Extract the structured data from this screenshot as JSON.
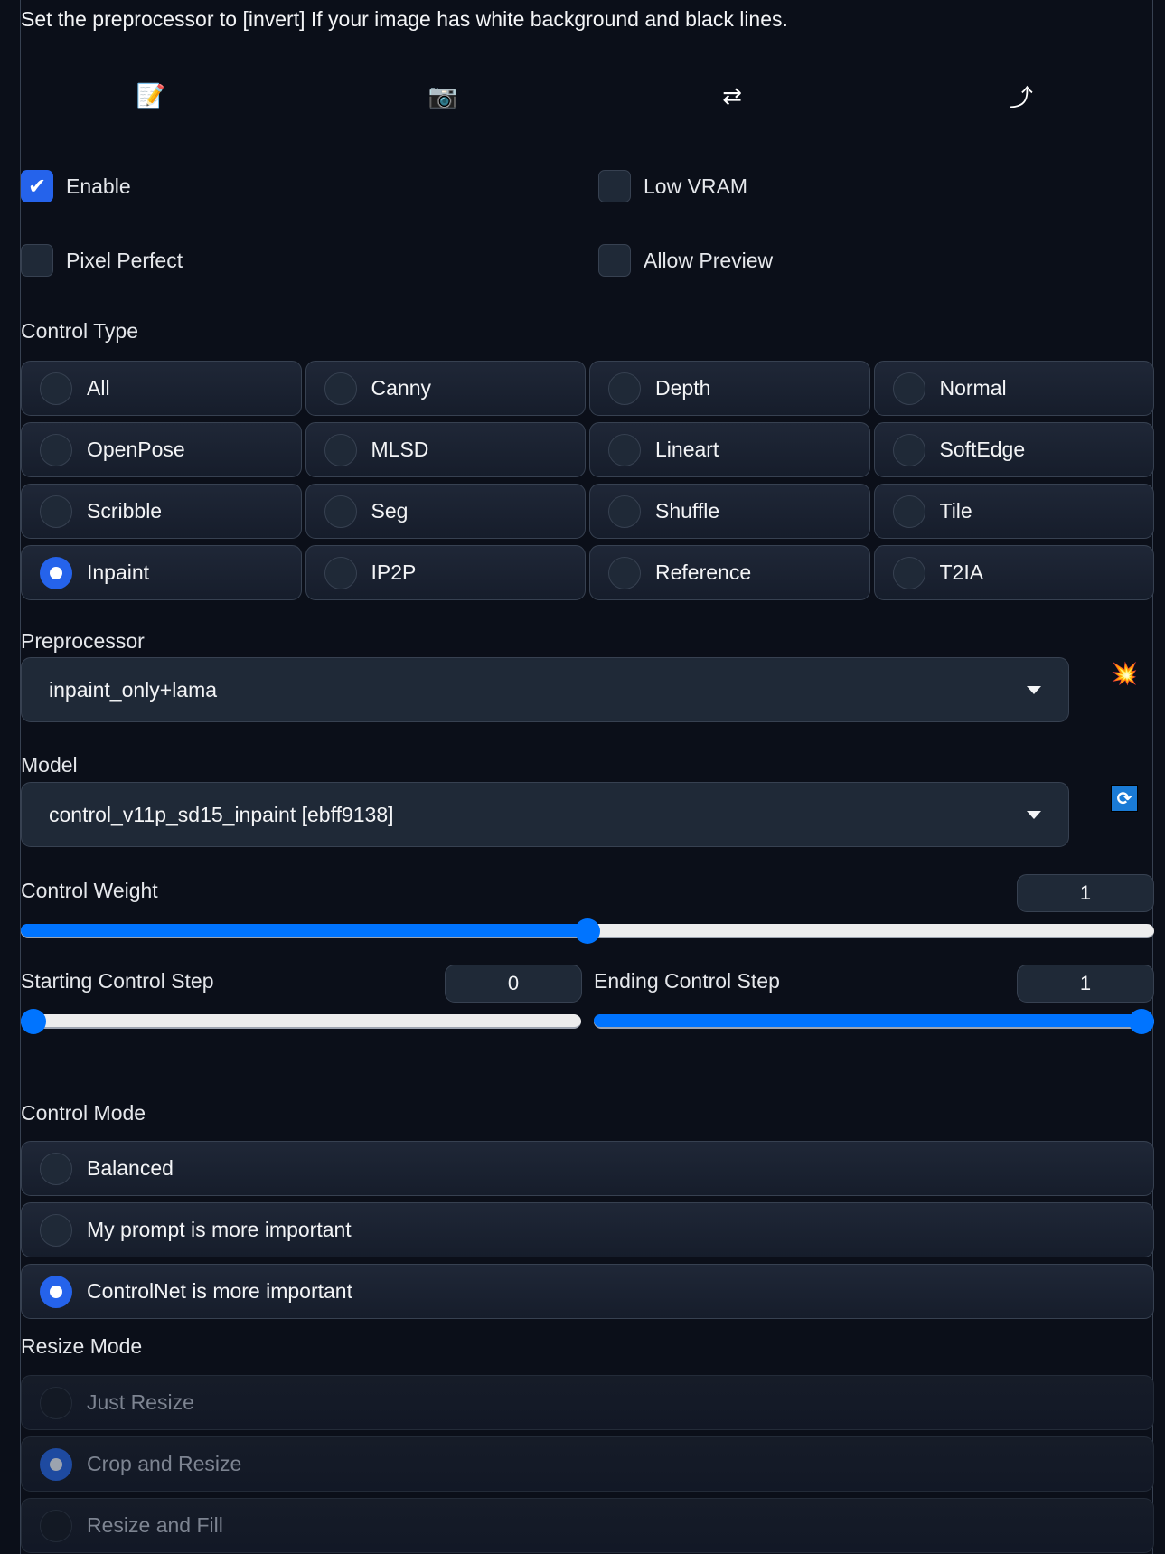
{
  "hint_text": "Set the preprocessor to [invert] If your image has white background and black lines.",
  "toolbar_icons": [
    {
      "name": "memo-icon",
      "glyph": "📝"
    },
    {
      "name": "camera-icon",
      "glyph": "📷"
    },
    {
      "name": "swap-arrows-icon",
      "glyph": "⇄"
    },
    {
      "name": "send-arrow-icon",
      "glyph": "⤴"
    }
  ],
  "checkboxes": {
    "enable": {
      "label": "Enable",
      "checked": true
    },
    "low_vram": {
      "label": "Low VRAM",
      "checked": false
    },
    "pixel_perfect": {
      "label": "Pixel Perfect",
      "checked": false
    },
    "allow_preview": {
      "label": "Allow Preview",
      "checked": false
    }
  },
  "control_type": {
    "label": "Control Type",
    "selected": "Inpaint",
    "options": [
      "All",
      "Canny",
      "Depth",
      "Normal",
      "OpenPose",
      "MLSD",
      "Lineart",
      "SoftEdge",
      "Scribble",
      "Seg",
      "Shuffle",
      "Tile",
      "Inpaint",
      "IP2P",
      "Reference",
      "T2IA"
    ]
  },
  "preprocessor": {
    "label": "Preprocessor",
    "value": "inpaint_only+lama",
    "run_icon": "💥"
  },
  "model": {
    "label": "Model",
    "value": "control_v11p_sd15_inpaint [ebff9138]",
    "refresh_icon": "🔄"
  },
  "control_weight": {
    "label": "Control Weight",
    "value": "1",
    "min": 0,
    "max": 2,
    "fraction": 0.5
  },
  "starting_step": {
    "label": "Starting Control Step",
    "value": "0",
    "fraction": 0.0
  },
  "ending_step": {
    "label": "Ending Control Step",
    "value": "1",
    "fraction": 1.0
  },
  "control_mode": {
    "label": "Control Mode",
    "selected": "ControlNet is more important",
    "options": [
      "Balanced",
      "My prompt is more important",
      "ControlNet is more important"
    ]
  },
  "resize_mode": {
    "label": "Resize Mode",
    "selected": "Crop and Resize",
    "disabled": true,
    "options": [
      "Just Resize",
      "Crop and Resize",
      "Resize and Fill"
    ]
  },
  "colors": {
    "accent": "#2563eb",
    "slider": "#0074ff",
    "background": "#0b0f19",
    "panel": "#1f2937"
  }
}
